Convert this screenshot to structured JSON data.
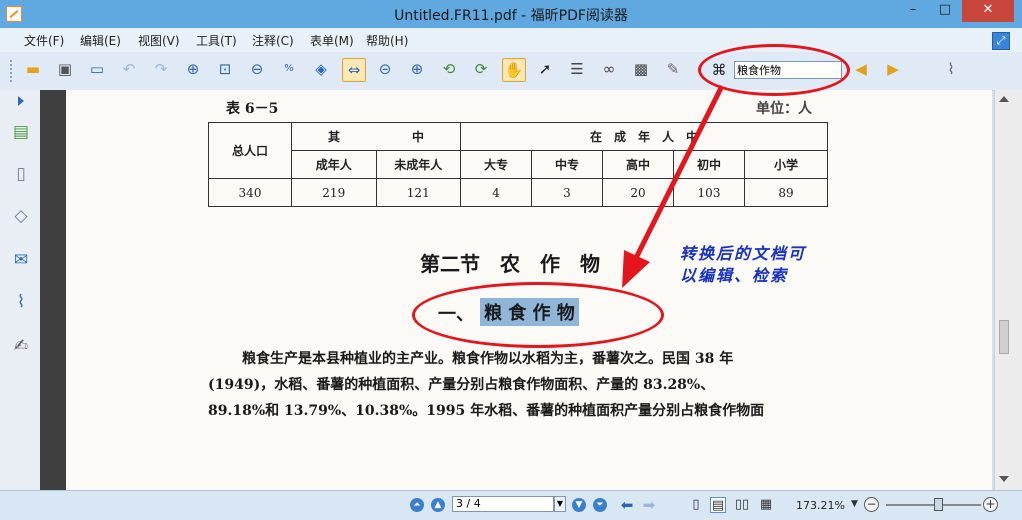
{
  "window": {
    "title": "Untitled.FR11.pdf - 福昕PDF阅读器",
    "minimize": "–",
    "maximize": "□",
    "close": "✕"
  },
  "menu": [
    {
      "label": "文件(F)"
    },
    {
      "label": "编辑(E)"
    },
    {
      "label": "视图(V)"
    },
    {
      "label": "工具(T)"
    },
    {
      "label": "注释(C)"
    },
    {
      "label": "表单(M)"
    },
    {
      "label": "帮助(H)"
    }
  ],
  "toolbar": {
    "icons": [
      "open-folder-icon",
      "save-icon",
      "monitor-icon",
      "undo-icon",
      "redo-icon",
      "zoom-in-icon",
      "marquee-zoom-icon",
      "zoom-out-icon",
      "actual-size-icon",
      "fit-page-icon",
      "fit-width-icon",
      "zoom-minus-icon",
      "zoom-plus-icon",
      "rotate-left-icon",
      "rotate-right-icon",
      "hand-tool-icon",
      "select-arrow-icon",
      "text-select-icon",
      "loupe-icon",
      "snapshot-icon",
      "typewriter-icon"
    ],
    "search_value": "粮食作物",
    "colors": {
      "highlight": "#8fb6d8",
      "annotation_red": "#e4151c",
      "note_blue": "#1730c7"
    }
  },
  "sidebar": {
    "icons": [
      "bookmarks-icon",
      "pages-icon",
      "layers-icon",
      "comments-icon",
      "attachments-icon",
      "signature-icon"
    ]
  },
  "document": {
    "table_label": "表 6－5",
    "unit_label": "单位：人",
    "table": {
      "row1": [
        "总人口",
        "其",
        "中",
        "在　成　年　人　中"
      ],
      "row2": [
        "成年人",
        "未成年人",
        "大专",
        "中专",
        "高中",
        "初中",
        "小学"
      ],
      "values": [
        "340",
        "219",
        "121",
        "4",
        "3",
        "20",
        "103",
        "89"
      ]
    },
    "section_title": "第二节　农　作　物",
    "subsection_prefix": "一、",
    "subsection_highlight": "粮 食 作 物",
    "paragraph": [
      "粮食生产是本县种植业的主产业。粮食作物以水稻为主，番薯次之。民国 38 年",
      "(1949)，水稻、番薯的种植面积、产量分别占粮食作物面积、产量的 83.28%、",
      "89.18%和 13.79%、10.38%。1995 年水稻、番薯的种植面积产量分别占粮食作物面"
    ],
    "note_line1": "转换后的文档可",
    "note_line2": "以编辑、检索"
  },
  "status": {
    "page_indicator": "3 / 4",
    "zoom": "173.21%",
    "zoom_fraction": 0.5
  }
}
